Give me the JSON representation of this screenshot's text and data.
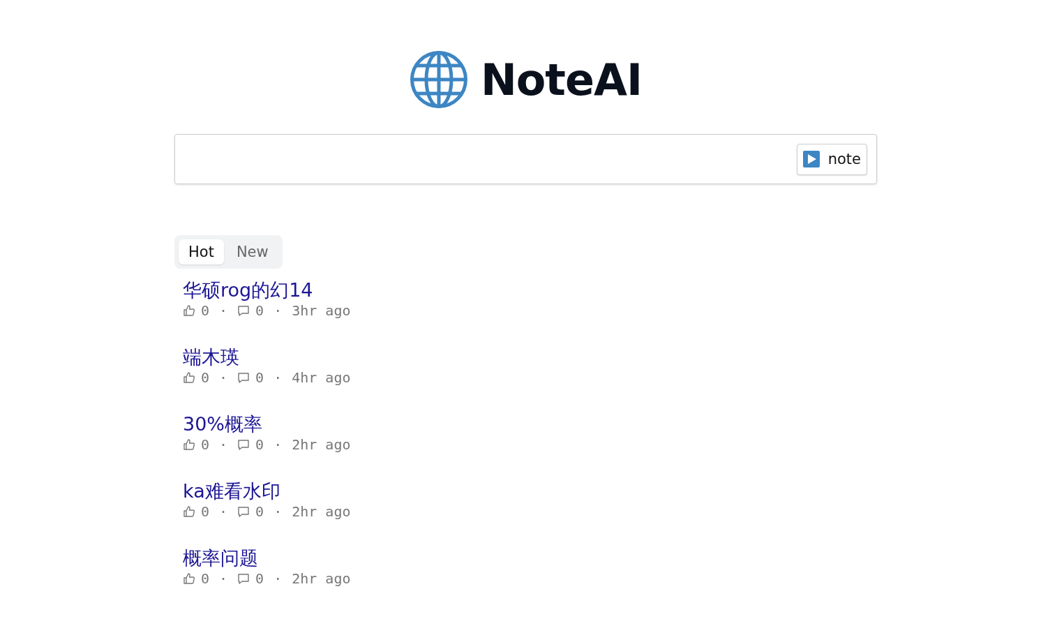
{
  "brand": {
    "title": "NoteAI"
  },
  "note_button": {
    "label": "note"
  },
  "tabs": [
    {
      "label": "Hot",
      "selected": true
    },
    {
      "label": "New",
      "selected": false
    }
  ],
  "posts": [
    {
      "title": "华硕rog的幻14",
      "likes": "0",
      "separator_1": "·",
      "comments": "0",
      "separator_2": "·",
      "time": "3hr ago"
    },
    {
      "title": "端木瑛",
      "likes": "0",
      "separator_1": "·",
      "comments": "0",
      "separator_2": "·",
      "time": "4hr ago"
    },
    {
      "title": "30%概率",
      "likes": "0",
      "separator_1": "·",
      "comments": "0",
      "separator_2": "·",
      "time": "2hr ago"
    },
    {
      "title": "ka难看水印",
      "likes": "0",
      "separator_1": "·",
      "comments": "0",
      "separator_2": "·",
      "time": "2hr ago"
    },
    {
      "title": "概率问题",
      "likes": "0",
      "separator_1": "·",
      "comments": "0",
      "separator_2": "·",
      "time": "2hr ago"
    }
  ]
}
